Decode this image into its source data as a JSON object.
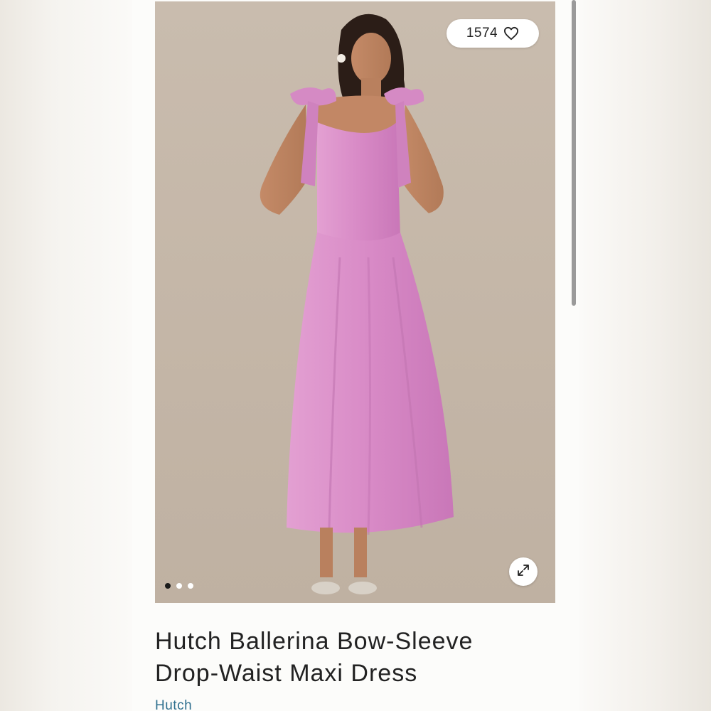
{
  "product": {
    "like_count": "1574",
    "title_line1": "Hutch Ballerina Bow-Sleeve",
    "title_line2": "Drop-Waist Maxi Dress",
    "brand": "Hutch"
  },
  "icons": {
    "like": "heart-icon",
    "expand": "expand-icon"
  },
  "carousel": {
    "total": 3,
    "active_index": 0
  },
  "colors": {
    "dress": "#d98fc7",
    "backdrop": "#c4b6a7",
    "brand_link": "#2e6f8e"
  }
}
